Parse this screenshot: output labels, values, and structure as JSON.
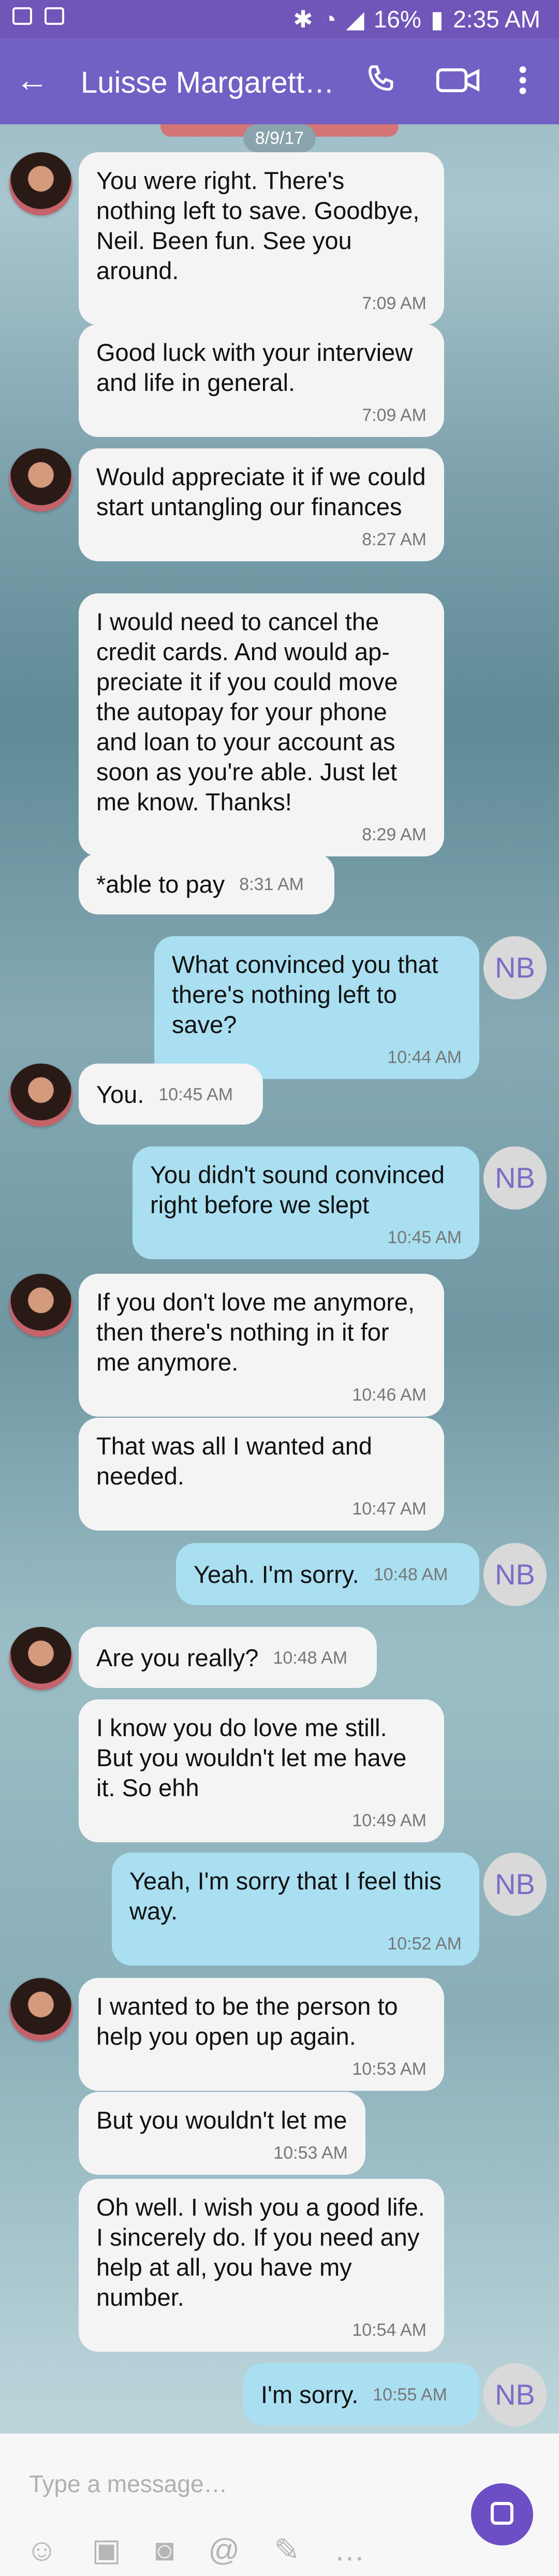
{
  "status_bar": {
    "battery": "16%",
    "time": "2:35 AM"
  },
  "header": {
    "back_icon": "back-arrow-icon",
    "contact_name": "Luisse Margarette…",
    "call_icon": "phone-icon",
    "video_icon": "video-icon",
    "menu_icon": "kebab-menu-icon"
  },
  "date_separator": "8/9/17",
  "messages": [
    {
      "dir": "in",
      "text": "You were right. There's nothing left to save. Goodbye, Neil. Been fun. See you around.",
      "time": "7:09 AM"
    },
    {
      "dir": "in",
      "text": "Good luck with your interview and life in general.",
      "time": "7:09 AM"
    },
    {
      "dir": "in",
      "text": "Would appreciate it if we could start untangling our finances",
      "time": "8:27 AM"
    },
    {
      "dir": "in",
      "text": "I would need to cancel the credit cards. And would ap-preciate it if you could move the autopay for your phone and loan to your account as soon as you're able. Just let me know. Thanks!",
      "time": "8:29 AM"
    },
    {
      "dir": "in",
      "text": "*able to pay",
      "time": "8:31 AM"
    },
    {
      "dir": "out",
      "text": "What convinced you that there's nothing left to save?",
      "time": "10:44 AM"
    },
    {
      "dir": "in",
      "text": "You.",
      "time": "10:45 AM"
    },
    {
      "dir": "out",
      "text": "You didn't sound convinced right before we slept",
      "time": "10:45 AM"
    },
    {
      "dir": "in",
      "text": "If you don't love me anymore, then there's nothing in it for me anymore.",
      "time": "10:46 AM"
    },
    {
      "dir": "in",
      "text": "That was all I wanted and needed.",
      "time": "10:47 AM"
    },
    {
      "dir": "out",
      "text": "Yeah. I'm sorry.",
      "time": "10:48 AM"
    },
    {
      "dir": "in",
      "text": "Are you really?",
      "time": "10:48 AM"
    },
    {
      "dir": "in",
      "text": "I know you do love me still. But you wouldn't let me have it. So ehh",
      "time": "10:49 AM"
    },
    {
      "dir": "out",
      "text": "Yeah, I'm sorry that I feel this way.",
      "time": "10:52 AM"
    },
    {
      "dir": "in",
      "text": "I wanted to be the person to help you open up again.",
      "time": "10:53 AM"
    },
    {
      "dir": "in",
      "text": "But you wouldn't let me",
      "time": "10:53 AM"
    },
    {
      "dir": "in",
      "text": "Oh well. I wish you a good life. I sincerely do. If you need any help at all, you have my number.",
      "time": "10:54 AM"
    },
    {
      "dir": "out",
      "text": "I'm sorry.",
      "time": "10:55 AM"
    }
  ],
  "self_initials": "NB",
  "composer": {
    "placeholder": "Type a message…",
    "send_icon": "send-icon"
  }
}
